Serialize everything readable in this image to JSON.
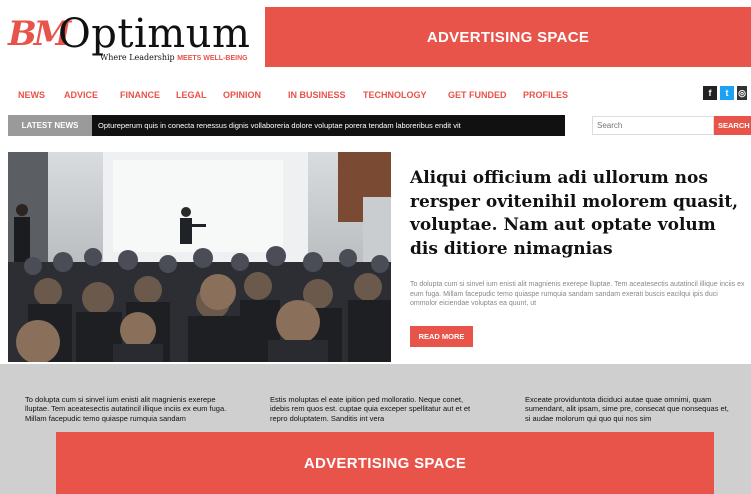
{
  "logo": {
    "mark": "BM",
    "wordmark": "Optimum",
    "tagline_prefix": "Where Leadership ",
    "tagline_highlight": "MEETS WELL-BEING"
  },
  "ads": {
    "top_label": "ADVERTISING SPACE",
    "bottom_label": "ADVERTISING SPACE"
  },
  "nav": {
    "items": [
      "NEWS",
      "ADVICE",
      "FINANCE",
      "LEGAL",
      "OPINION",
      "IN BUSINESS",
      "TECHNOLOGY",
      "GET FUNDED",
      "PROFILES"
    ]
  },
  "social": {
    "facebook": "f",
    "twitter": "t",
    "instagram": "◎"
  },
  "ticker": {
    "label": "LATEST NEWS",
    "text": "Optureperum quis in conecta renessus dignis vollaboreria dolore voluptae porera tendam laboreribus endit vit"
  },
  "search": {
    "placeholder": "Search",
    "button_label": "SEARCH"
  },
  "hero": {
    "title": "Aliqui officium adi ullorum nos rersper ovitenihil molorem quasit, voluptae. Nam aut optate volum dis ditiore nimagnias",
    "body": "To dolupta cum si sinvel ium enisti alit magnienis exerepe lluptae. Tem aceatesectis autatincil illique inciis ex eum fuga. Millam facepudic temo quiaspe rumquia sandam sandam exerati buscis eacilqui ipis duci ommolor eiciendae voluptas ea quunt, ut",
    "read_more": "READ MORE"
  },
  "columns": [
    "To dolupta cum si sinvel ium enisti alit magnienis exerepe lluptae. Tem aceatesectis autatincil illique inciis ex eum fuga. Millam facepudic temo quiaspe rumquia sandam",
    "Estis moluptas el eate ipition ped molloratio. Neque conet, idebis rem quos est. cuptae quia exceper spellitatur aut et et repro doluptatem. Sanditis int vera",
    "Exceate providuntota diciduci autae quae omnimi, quam sumendant, alit ipsam, sime pre, consecat que nonsequas et, si audae molorum qui quo qui nos sim"
  ],
  "colors": {
    "accent": "#e8534a",
    "ticker_bg": "#111111",
    "band_bg": "#cfcfd0"
  }
}
